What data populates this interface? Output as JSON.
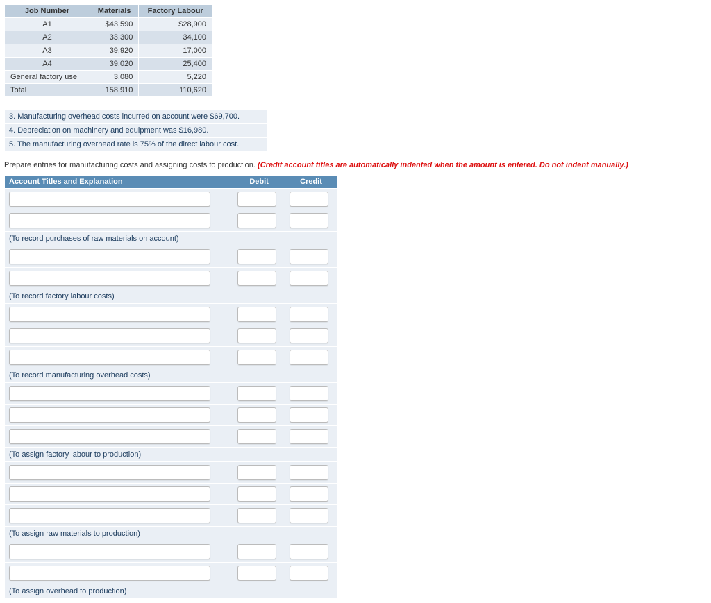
{
  "costTable": {
    "headers": [
      "Job Number",
      "Materials",
      "Factory Labour"
    ],
    "rows": [
      {
        "job": "A1",
        "materials": "$43,590",
        "labour": "$28,900"
      },
      {
        "job": "A2",
        "materials": "33,300",
        "labour": "34,100"
      },
      {
        "job": "A3",
        "materials": "39,920",
        "labour": "17,000"
      },
      {
        "job": "A4",
        "materials": "39,020",
        "labour": "25,400"
      },
      {
        "job": "General factory use",
        "materials": "3,080",
        "labour": "5,220"
      },
      {
        "job": "Total",
        "materials": "158,910",
        "labour": "110,620"
      }
    ]
  },
  "notes": {
    "n3": "3. Manufacturing overhead costs incurred on account were $69,700.",
    "n4": "4. Depreciation on machinery and equipment was $16,980.",
    "n5": "5. The manufacturing overhead rate is 75% of the direct labour cost."
  },
  "instruction": {
    "text": "Prepare entries for manufacturing costs and assigning costs to production. ",
    "red": "(Credit account titles are automatically indented when the amount is entered. Do not indent manually.)"
  },
  "entryHeaders": {
    "acct": "Account Titles and Explanation",
    "debit": "Debit",
    "credit": "Credit"
  },
  "descriptions": {
    "d1": "(To record purchases of raw materials on account)",
    "d2": "(To record factory labour costs)",
    "d3": "(To record manufacturing overhead costs)",
    "d4": "(To assign factory labour to production)",
    "d5": "(To assign raw materials to production)",
    "d6": "(To assign overhead to production)"
  }
}
